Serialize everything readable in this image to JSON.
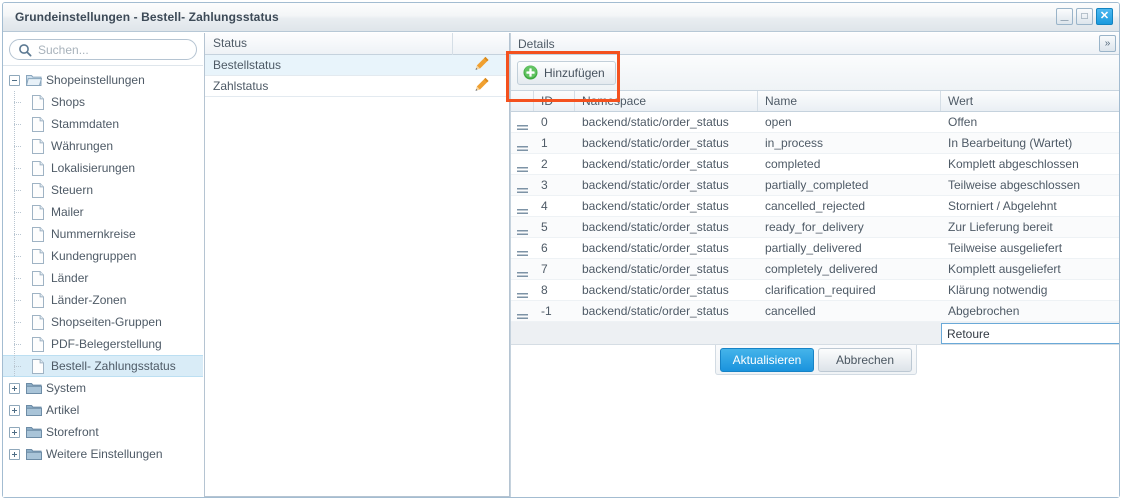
{
  "window": {
    "title": "Grundeinstellungen - Bestell- Zahlungsstatus",
    "buttons": {
      "minimize": "minimize-icon",
      "maximize": "maximize-icon",
      "close": "close-icon",
      "minimize_glyph": "_",
      "maximize_glyph": "□",
      "close_glyph": "✕"
    }
  },
  "sidebar": {
    "search": {
      "placeholder": "Suchen...",
      "value": "",
      "icon": "search-icon"
    },
    "tree": [
      {
        "label": "Shopeinstellungen",
        "type": "folder",
        "state": "expanded",
        "depth": 0,
        "selected": false
      },
      {
        "label": "Shops",
        "type": "file",
        "state": "leaf",
        "depth": 1,
        "selected": false
      },
      {
        "label": "Stammdaten",
        "type": "file",
        "state": "leaf",
        "depth": 1,
        "selected": false
      },
      {
        "label": "Währungen",
        "type": "file",
        "state": "leaf",
        "depth": 1,
        "selected": false
      },
      {
        "label": "Lokalisierungen",
        "type": "file",
        "state": "leaf",
        "depth": 1,
        "selected": false
      },
      {
        "label": "Steuern",
        "type": "file",
        "state": "leaf",
        "depth": 1,
        "selected": false
      },
      {
        "label": "Mailer",
        "type": "file",
        "state": "leaf",
        "depth": 1,
        "selected": false
      },
      {
        "label": "Nummernkreise",
        "type": "file",
        "state": "leaf",
        "depth": 1,
        "selected": false
      },
      {
        "label": "Kundengruppen",
        "type": "file",
        "state": "leaf",
        "depth": 1,
        "selected": false
      },
      {
        "label": "Länder",
        "type": "file",
        "state": "leaf",
        "depth": 1,
        "selected": false
      },
      {
        "label": "Länder-Zonen",
        "type": "file",
        "state": "leaf",
        "depth": 1,
        "selected": false
      },
      {
        "label": "Shopseiten-Gruppen",
        "type": "file",
        "state": "leaf",
        "depth": 1,
        "selected": false
      },
      {
        "label": "PDF-Belegerstellung",
        "type": "file",
        "state": "leaf",
        "depth": 1,
        "selected": false
      },
      {
        "label": "Bestell- Zahlungsstatus",
        "type": "file",
        "state": "leaf",
        "depth": 1,
        "selected": true
      },
      {
        "label": "System",
        "type": "folder",
        "state": "collapsed",
        "depth": 0,
        "selected": false
      },
      {
        "label": "Artikel",
        "type": "folder",
        "state": "collapsed",
        "depth": 0,
        "selected": false
      },
      {
        "label": "Storefront",
        "type": "folder",
        "state": "collapsed",
        "depth": 0,
        "selected": false
      },
      {
        "label": "Weitere Einstellungen",
        "type": "folder",
        "state": "collapsed",
        "depth": 0,
        "selected": false
      }
    ]
  },
  "status_panel": {
    "columns": [
      "Status",
      ""
    ],
    "rows": [
      {
        "status": "Bestellstatus",
        "edit_icon": "pencil-icon",
        "selected": true
      },
      {
        "status": "Zahlstatus",
        "edit_icon": "pencil-icon",
        "selected": false
      }
    ]
  },
  "details_panel": {
    "title": "Details",
    "collapse_glyph": "»",
    "toolbar": {
      "add_label": "Hinzufügen",
      "add_icon": "plus-circle-icon"
    },
    "highlight_color": "#f4511e",
    "columns": [
      "",
      "ID",
      "Namespace",
      "Name",
      "Wert"
    ],
    "rows": [
      {
        "id": "0",
        "namespace": "backend/static/order_status",
        "name": "open",
        "wert": "Offen"
      },
      {
        "id": "1",
        "namespace": "backend/static/order_status",
        "name": "in_process",
        "wert": "In Bearbeitung (Wartet)"
      },
      {
        "id": "2",
        "namespace": "backend/static/order_status",
        "name": "completed",
        "wert": "Komplett abgeschlossen"
      },
      {
        "id": "3",
        "namespace": "backend/static/order_status",
        "name": "partially_completed",
        "wert": "Teilweise abgeschlossen"
      },
      {
        "id": "4",
        "namespace": "backend/static/order_status",
        "name": "cancelled_rejected",
        "wert": "Storniert / Abgelehnt"
      },
      {
        "id": "5",
        "namespace": "backend/static/order_status",
        "name": "ready_for_delivery",
        "wert": "Zur Lieferung bereit"
      },
      {
        "id": "6",
        "namespace": "backend/static/order_status",
        "name": "partially_delivered",
        "wert": "Teilweise ausgeliefert"
      },
      {
        "id": "7",
        "namespace": "backend/static/order_status",
        "name": "completely_delivered",
        "wert": "Komplett ausgeliefert"
      },
      {
        "id": "8",
        "namespace": "backend/static/order_status",
        "name": "clarification_required",
        "wert": "Klärung notwendig"
      },
      {
        "id": "-1",
        "namespace": "backend/static/order_status",
        "name": "cancelled",
        "wert": "Abgebrochen"
      }
    ],
    "edit_row": {
      "input_value": "Retoure",
      "input_placeholder": ""
    },
    "actions": {
      "update_label": "Aktualisieren",
      "cancel_label": "Abbrechen",
      "primary_color": "#1a93dd"
    }
  }
}
